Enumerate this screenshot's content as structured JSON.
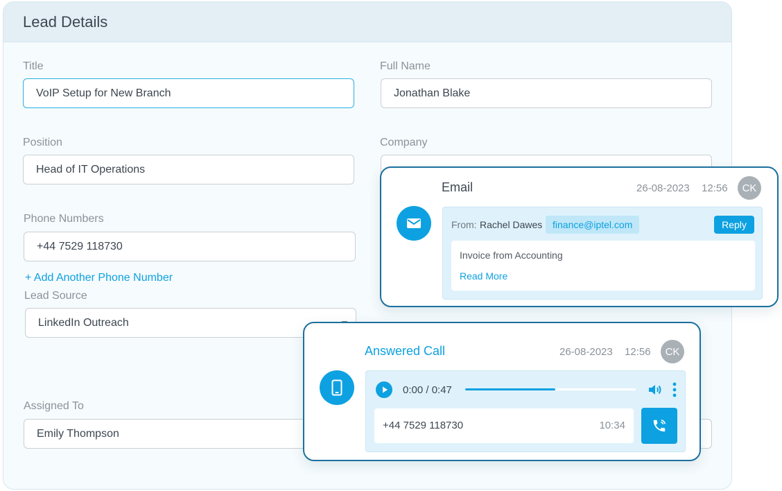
{
  "lead": {
    "header": "Lead Details",
    "fields": {
      "title": {
        "label": "Title",
        "value": "VoIP Setup for New Branch"
      },
      "full_name": {
        "label": "Full Name",
        "value": "Jonathan Blake"
      },
      "position": {
        "label": "Position",
        "value": "Head of IT Operations"
      },
      "company": {
        "label": "Company",
        "value": ""
      },
      "phone": {
        "label": "Phone Numbers",
        "value": "+44 7529 118730"
      },
      "add_phone": "+ Add Another Phone Number",
      "lead_source": {
        "label": "Lead Source",
        "value": "LinkedIn Outreach"
      },
      "assigned_to": {
        "label": "Assigned To",
        "value": "Emily Thompson"
      }
    }
  },
  "email_card": {
    "title": "Email",
    "date": "26-08-2023",
    "time": "12:56",
    "avatar": "CK",
    "from_label": "From:",
    "from_name": "Rachel Dawes",
    "from_email": "finance@iptel.com",
    "reply": "Reply",
    "subject": "Invoice from Accounting",
    "read_more": "Read More"
  },
  "call_card": {
    "title": "Answered Call",
    "date": "26-08-2023",
    "time": "12:56",
    "avatar": "CK",
    "player_time": "0:00 / 0:47",
    "progress": 0.53,
    "number": "+44 7529 118730",
    "duration": "10:34"
  },
  "colors": {
    "accent": "#0da1e1",
    "card_border": "#1b6f9e",
    "avatar": "#a9b0b6"
  },
  "icons": [
    "mail-icon",
    "phone-icon",
    "play-icon",
    "volume-icon",
    "more-vertical-icon",
    "call-back-icon"
  ]
}
